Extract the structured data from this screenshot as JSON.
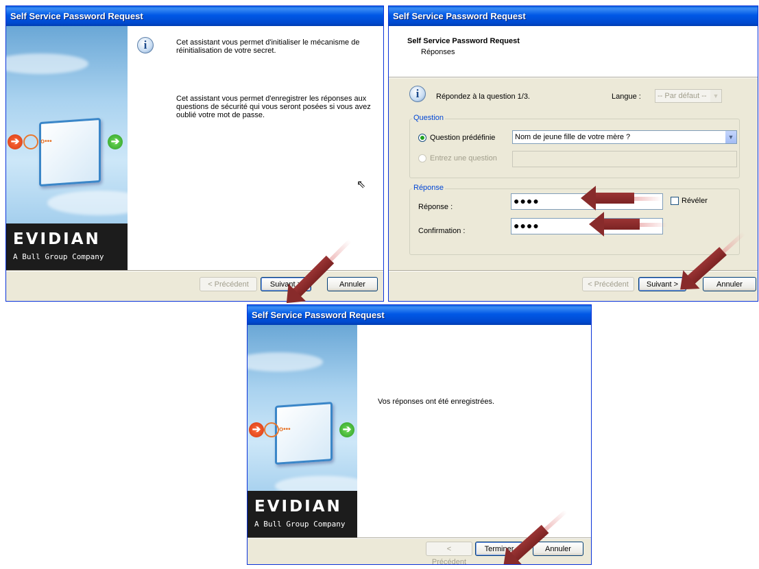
{
  "colors": {
    "title_bar": "#0054e3",
    "dialog_bg": "#ece9d8",
    "arrow": "#882b2b",
    "group_label": "#0046d5"
  },
  "brand": {
    "logo": "EVIDIAN",
    "tagline": "A Bull Group Company"
  },
  "window1": {
    "title": "Self Service Password Request",
    "paragraph1": "Cet assistant vous permet d'initialiser le mécanisme de réinitialisation de votre secret.",
    "paragraph2": "Cet assistant vous permet d'enregistrer les réponses aux questions de sécurité qui vous seront posées si vous avez oublié votre mot de passe.",
    "buttons": {
      "back": "< Précédent",
      "next": "Suivant >",
      "cancel": "Annuler"
    }
  },
  "window2": {
    "title": "Self Service Password Request",
    "header_title": "Self Service Password Request",
    "header_subtitle": "Réponses",
    "instruction": "Répondez à la question 1/3.",
    "language_label": "Langue :",
    "language_value": "-- Par défaut --",
    "question_group": "Question",
    "predefined_label": "Question prédéfinie",
    "predefined_value": "Nom de jeune fille de votre mère ?",
    "custom_label": "Entrez une question",
    "answer_group": "Réponse",
    "answer_label": "Réponse :",
    "answer_value": "●●●●",
    "confirm_label": "Confirmation :",
    "confirm_value": "●●●●",
    "reveal_label": "Révéler",
    "buttons": {
      "back": "< Précédent",
      "next": "Suivant >",
      "cancel": "Annuler"
    }
  },
  "window3": {
    "title": "Self Service Password Request",
    "message": "Vos réponses ont été enregistrées.",
    "buttons": {
      "back": "< Précédent",
      "finish": "Terminer",
      "cancel": "Annuler"
    }
  }
}
